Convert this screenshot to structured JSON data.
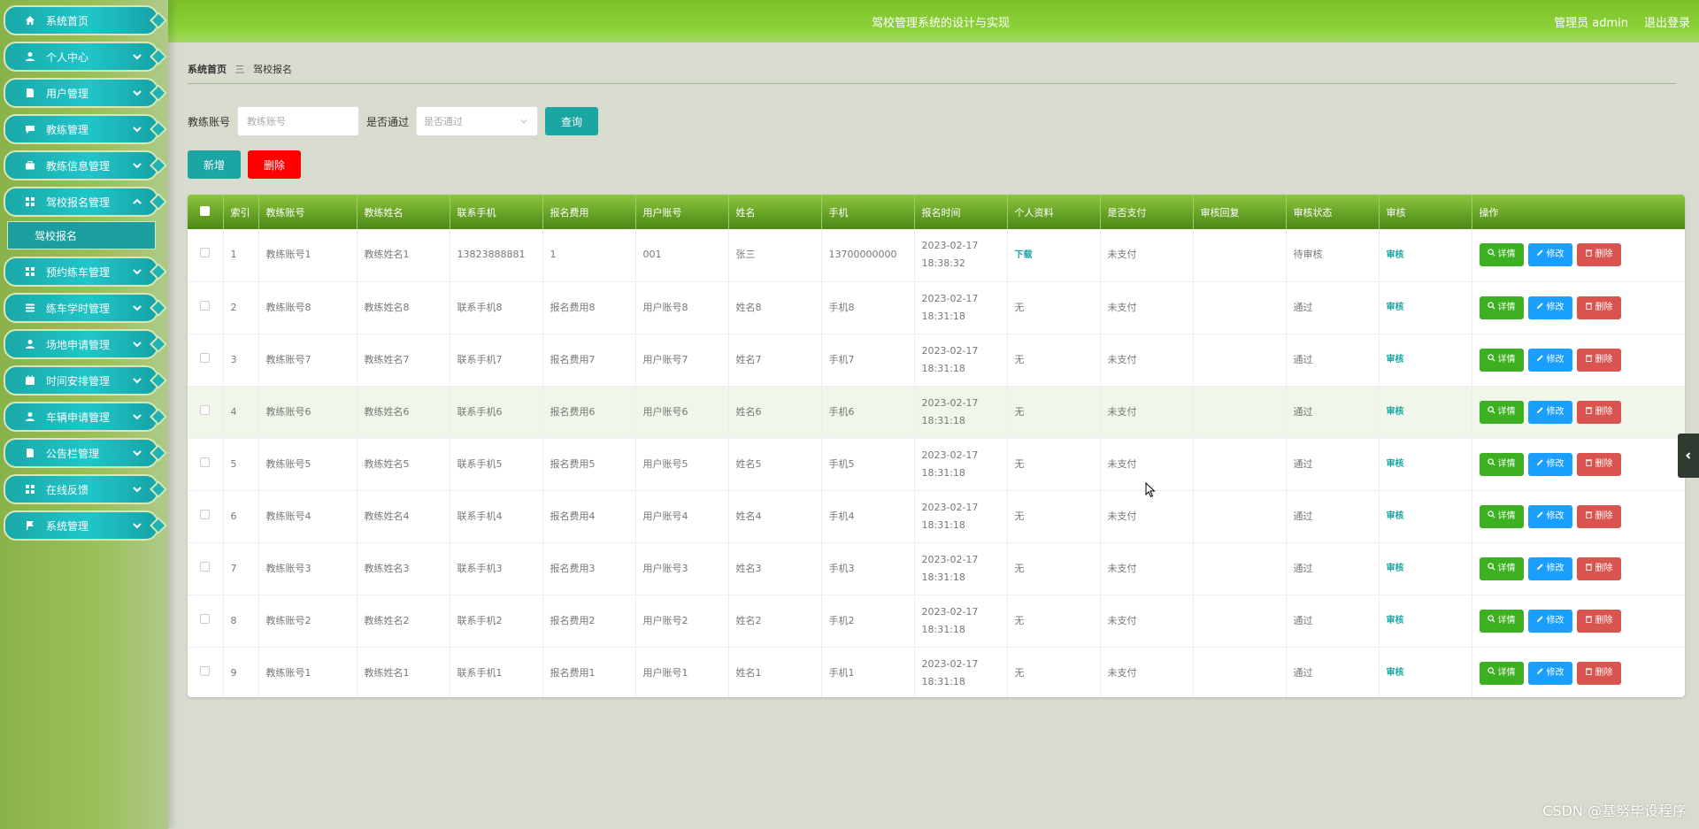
{
  "header": {
    "title": "驾校管理系统的设计与实现",
    "admin": "管理员 admin",
    "logout": "退出登录"
  },
  "sidebar": {
    "items": [
      {
        "label": "系统首页",
        "icon": "home-icon"
      },
      {
        "label": "个人中心",
        "icon": "user-icon"
      },
      {
        "label": "用户管理",
        "icon": "document-icon"
      },
      {
        "label": "教练管理",
        "icon": "chat-icon"
      },
      {
        "label": "教练信息管理",
        "icon": "briefcase-icon"
      },
      {
        "label": "驾校报名管理",
        "icon": "grid-icon"
      },
      {
        "label": "预约练车管理",
        "icon": "grid-icon"
      },
      {
        "label": "练车学时管理",
        "icon": "list-icon"
      },
      {
        "label": "场地申请管理",
        "icon": "user-icon"
      },
      {
        "label": "时间安排管理",
        "icon": "calendar-icon"
      },
      {
        "label": "车辆申请管理",
        "icon": "user-icon"
      },
      {
        "label": "公告栏管理",
        "icon": "document-icon"
      },
      {
        "label": "在线反馈",
        "icon": "grid-icon"
      },
      {
        "label": "系统管理",
        "icon": "flag-icon"
      }
    ],
    "active_sub": "驾校报名"
  },
  "breadcrumb": {
    "home": "系统首页",
    "sep": "三",
    "current": "驾校报名"
  },
  "search": {
    "label1": "教练账号",
    "placeholder1": "教练账号",
    "label2": "是否通过",
    "placeholder2": "是否通过",
    "query": "查询"
  },
  "actions": {
    "add": "新增",
    "delete": "删除"
  },
  "table": {
    "headers": [
      "索引",
      "教练账号",
      "教练姓名",
      "联系手机",
      "报名费用",
      "用户账号",
      "姓名",
      "手机",
      "报名时间",
      "个人资料",
      "是否支付",
      "审核回复",
      "审核状态",
      "审核",
      "操作"
    ],
    "rows": [
      [
        "1",
        "教练账号1",
        "教练姓名1",
        "13823888881",
        "1",
        "001",
        "张三",
        "13700000000",
        "2023-02-17 18:38:32",
        "下载",
        "未支付",
        "",
        "待审核",
        "审核"
      ],
      [
        "2",
        "教练账号8",
        "教练姓名8",
        "联系手机8",
        "报名费用8",
        "用户账号8",
        "姓名8",
        "手机8",
        "2023-02-17 18:31:18",
        "无",
        "未支付",
        "",
        "通过",
        "审核"
      ],
      [
        "3",
        "教练账号7",
        "教练姓名7",
        "联系手机7",
        "报名费用7",
        "用户账号7",
        "姓名7",
        "手机7",
        "2023-02-17 18:31:18",
        "无",
        "未支付",
        "",
        "通过",
        "审核"
      ],
      [
        "4",
        "教练账号6",
        "教练姓名6",
        "联系手机6",
        "报名费用6",
        "用户账号6",
        "姓名6",
        "手机6",
        "2023-02-17 18:31:18",
        "无",
        "未支付",
        "",
        "通过",
        "审核"
      ],
      [
        "5",
        "教练账号5",
        "教练姓名5",
        "联系手机5",
        "报名费用5",
        "用户账号5",
        "姓名5",
        "手机5",
        "2023-02-17 18:31:18",
        "无",
        "未支付",
        "",
        "通过",
        "审核"
      ],
      [
        "6",
        "教练账号4",
        "教练姓名4",
        "联系手机4",
        "报名费用4",
        "用户账号4",
        "姓名4",
        "手机4",
        "2023-02-17 18:31:18",
        "无",
        "未支付",
        "",
        "通过",
        "审核"
      ],
      [
        "7",
        "教练账号3",
        "教练姓名3",
        "联系手机3",
        "报名费用3",
        "用户账号3",
        "姓名3",
        "手机3",
        "2023-02-17 18:31:18",
        "无",
        "未支付",
        "",
        "通过",
        "审核"
      ],
      [
        "8",
        "教练账号2",
        "教练姓名2",
        "联系手机2",
        "报名费用2",
        "用户账号2",
        "姓名2",
        "手机2",
        "2023-02-17 18:31:18",
        "无",
        "未支付",
        "",
        "通过",
        "审核"
      ],
      [
        "9",
        "教练账号1",
        "教练姓名1",
        "联系手机1",
        "报名费用1",
        "用户账号1",
        "姓名1",
        "手机1",
        "2023-02-17 18:31:18",
        "无",
        "未支付",
        "",
        "通过",
        "审核"
      ]
    ],
    "op_labels": {
      "detail": "详情",
      "edit": "修改",
      "remove": "删除"
    }
  },
  "watermark": "CSDN @基努毕设程序"
}
